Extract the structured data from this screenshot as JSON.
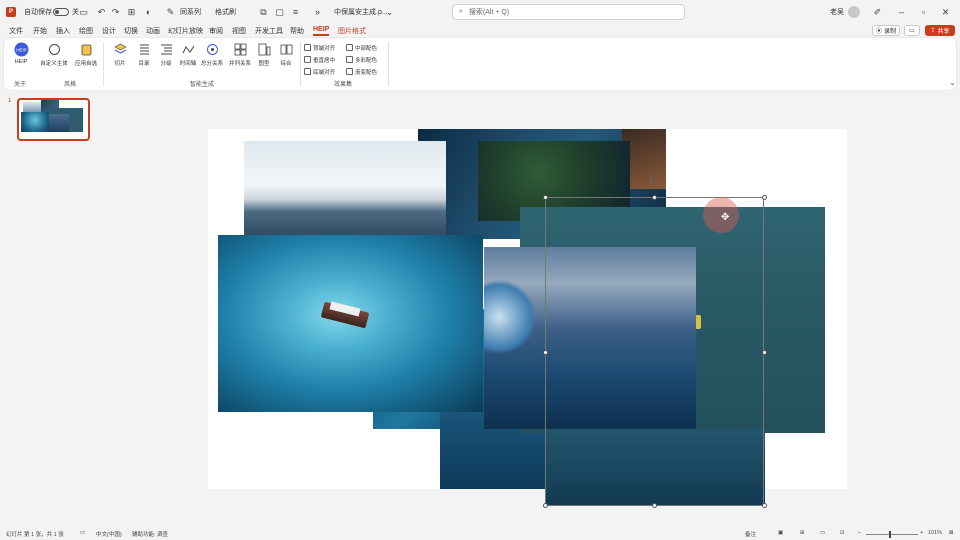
{
  "titlebar": {
    "app_icon": "P",
    "autosave_label": "自动保存",
    "toggle_state": "关",
    "tools_label": "同系列",
    "format_label": "格式刷",
    "filename": "中保属安主成.p...",
    "search_placeholder": "搜索(Alt + Q)",
    "user_name": "老吴"
  },
  "tabs": [
    {
      "label": "文件"
    },
    {
      "label": "开始"
    },
    {
      "label": "插入"
    },
    {
      "label": "绘图"
    },
    {
      "label": "设计"
    },
    {
      "label": "切换"
    },
    {
      "label": "动画"
    },
    {
      "label": "幻灯片放映"
    },
    {
      "label": "审阅"
    },
    {
      "label": "视图"
    },
    {
      "label": "开发工具"
    },
    {
      "label": "帮助"
    },
    {
      "label": "HEIP"
    },
    {
      "label": "图片格式"
    }
  ],
  "tab_right": {
    "record_label": "录制",
    "comment_label": "",
    "share_label": "共享"
  },
  "ribbon": {
    "buttons": [
      {
        "label": "HEIP",
        "icon": "heip-logo-icon"
      },
      {
        "label": "自定义主体",
        "icon": "circle-icon"
      },
      {
        "label": "应用自选",
        "icon": "cup-icon"
      },
      {
        "label": "切片",
        "icon": "layers-icon"
      },
      {
        "label": "目录",
        "icon": "list-icon"
      },
      {
        "label": "分级",
        "icon": "outline-icon"
      },
      {
        "label": "时间轴",
        "icon": "timeline-icon"
      },
      {
        "label": "总分关系",
        "icon": "hierarchy-icon"
      },
      {
        "label": "并列关系",
        "icon": "grid-icon"
      },
      {
        "label": "图型",
        "icon": "columns-icon"
      },
      {
        "label": "综合",
        "icon": "compare-icon"
      }
    ],
    "checks": [
      {
        "label": "顶端对齐"
      },
      {
        "label": "垂直居中"
      },
      {
        "label": "底端对齐"
      },
      {
        "label": "中部配色"
      },
      {
        "label": "多彩配色"
      },
      {
        "label": "渐变配色"
      }
    ],
    "groups": [
      {
        "label": "关于"
      },
      {
        "label": "风格"
      },
      {
        "label": "智能生成"
      },
      {
        "label": "效果集"
      }
    ]
  },
  "thumb": {
    "number": "1"
  },
  "statusbar": {
    "slide_info": "幻灯片 第 1 张，共 1 张",
    "language": "中文(中国)",
    "accessibility": "辅助功能: 调查",
    "notes": "备注",
    "zoom": "101%"
  },
  "colors": {
    "accent": "#c43e1c",
    "ocean_dark": "#0f3c55",
    "ocean_mid": "#2a7aa0",
    "ocean_light": "#4fb8d6"
  }
}
